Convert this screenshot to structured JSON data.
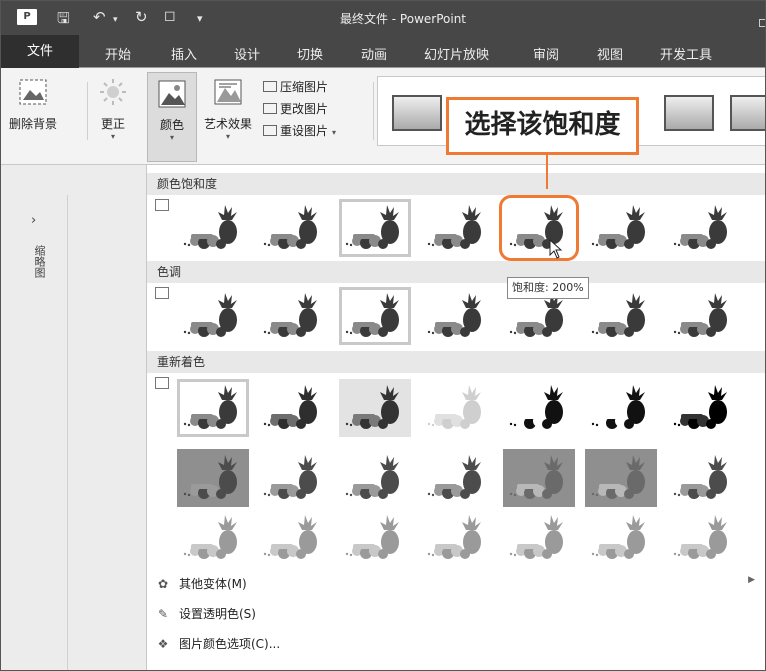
{
  "window": {
    "title": "最终文件 - PowerPoint",
    "app_icon": "P",
    "quick_access": [
      "save-icon",
      "undo-icon",
      "redo-icon",
      "new-slide-icon",
      "customize-icon"
    ]
  },
  "tabs": [
    {
      "label": "文件"
    },
    {
      "label": "开始"
    },
    {
      "label": "插入"
    },
    {
      "label": "设计"
    },
    {
      "label": "切换"
    },
    {
      "label": "动画"
    },
    {
      "label": "幻灯片放映"
    },
    {
      "label": "审阅"
    },
    {
      "label": "视图"
    },
    {
      "label": "开发工具"
    }
  ],
  "ribbon": {
    "remove_bg": "删除背景",
    "corrections": "更正",
    "color": "颜色",
    "artistic": "艺术效果",
    "compress": "压缩图片",
    "change_pic": "更改图片",
    "reset_pic": "重设图片"
  },
  "sidebar": {
    "expand_glyph": "›",
    "label": "缩略图"
  },
  "gallery": {
    "saturation_header": "颜色饱和度",
    "tone_header": "色调",
    "recolor_header": "重新着色",
    "tooltip": "饱和度: 200%",
    "menu": {
      "more_variants": "其他变体(M)",
      "set_transparent": "设置透明色(S)",
      "color_options": "图片颜色选项(C)..."
    }
  },
  "callout": {
    "text": "选择该饱和度",
    "accent": "#ee7a33"
  }
}
